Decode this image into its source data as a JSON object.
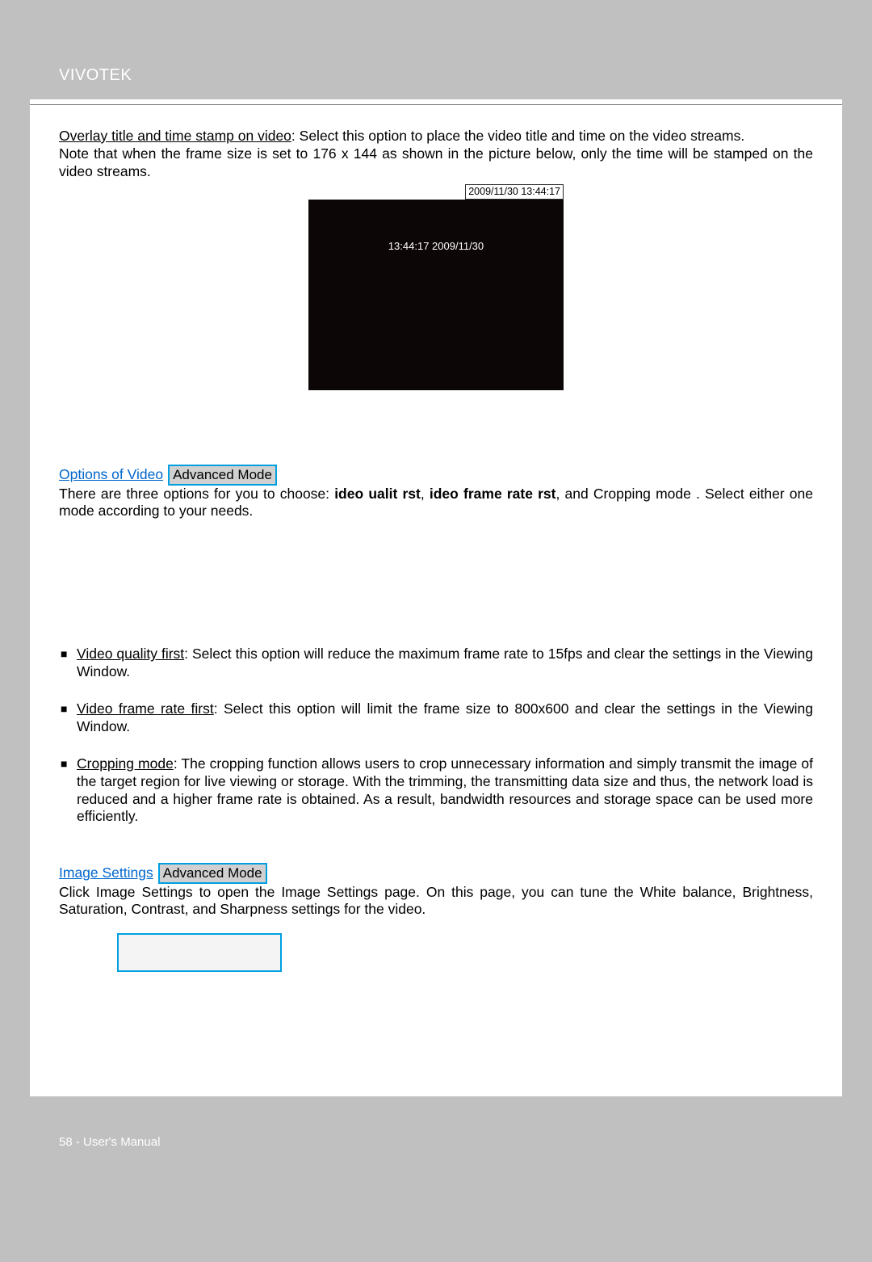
{
  "header": {
    "brand": "VIVOTEK"
  },
  "overlay": {
    "title": "Overlay title and time stamp on video",
    "desc_after": ": Select this option to place the video title and time on the video streams.",
    "note": "Note that when the frame size is set to 176 x 144 as shown in the picture below, only the time will be stamped on the video streams."
  },
  "video": {
    "timestamp_bar": "2009/11/30 13:44:17",
    "inner_text": "13:44:17 2009/11/30"
  },
  "options_section": {
    "link": "Options of Video",
    "badge": "Advanced Mode",
    "line_prefix": "There are three options for you to choose: ",
    "b1": "ideo  ualit   rst",
    "comma1": ", ",
    "b2": "ideo frame rate  rst",
    "after_b2": ", and Cropping mode . Select either one mode according to your needs."
  },
  "bullets": {
    "vqf_label": "Video quality first",
    "vqf_text": ": Select this option will reduce the maximum frame rate to 15fps and clear the settings in the Viewing Window.",
    "vfrf_label": "Video frame rate first",
    "vfrf_text": ": Select this option will limit the frame size to 800x600 and clear the settings in the Viewing Window.",
    "crop_label": "Cropping mode",
    "crop_text": ": The cropping function allows users to crop unnecessary information and simply transmit the image of the target region for live viewing or storage. With the trimming, the transmitting data size and thus, the network load is reduced and a higher frame rate is obtained. As a result, bandwidth resources and storage space can be used more efficiently."
  },
  "image_settings": {
    "link": "Image Settings",
    "badge": "Advanced Mode",
    "desc": "Click Image Settings  to open the Image Settings page. On this page, you can tune the White balance, Brightness, Saturation, Contrast, and Sharpness settings for the video."
  },
  "footer": {
    "text": "58 - User's Manual"
  }
}
